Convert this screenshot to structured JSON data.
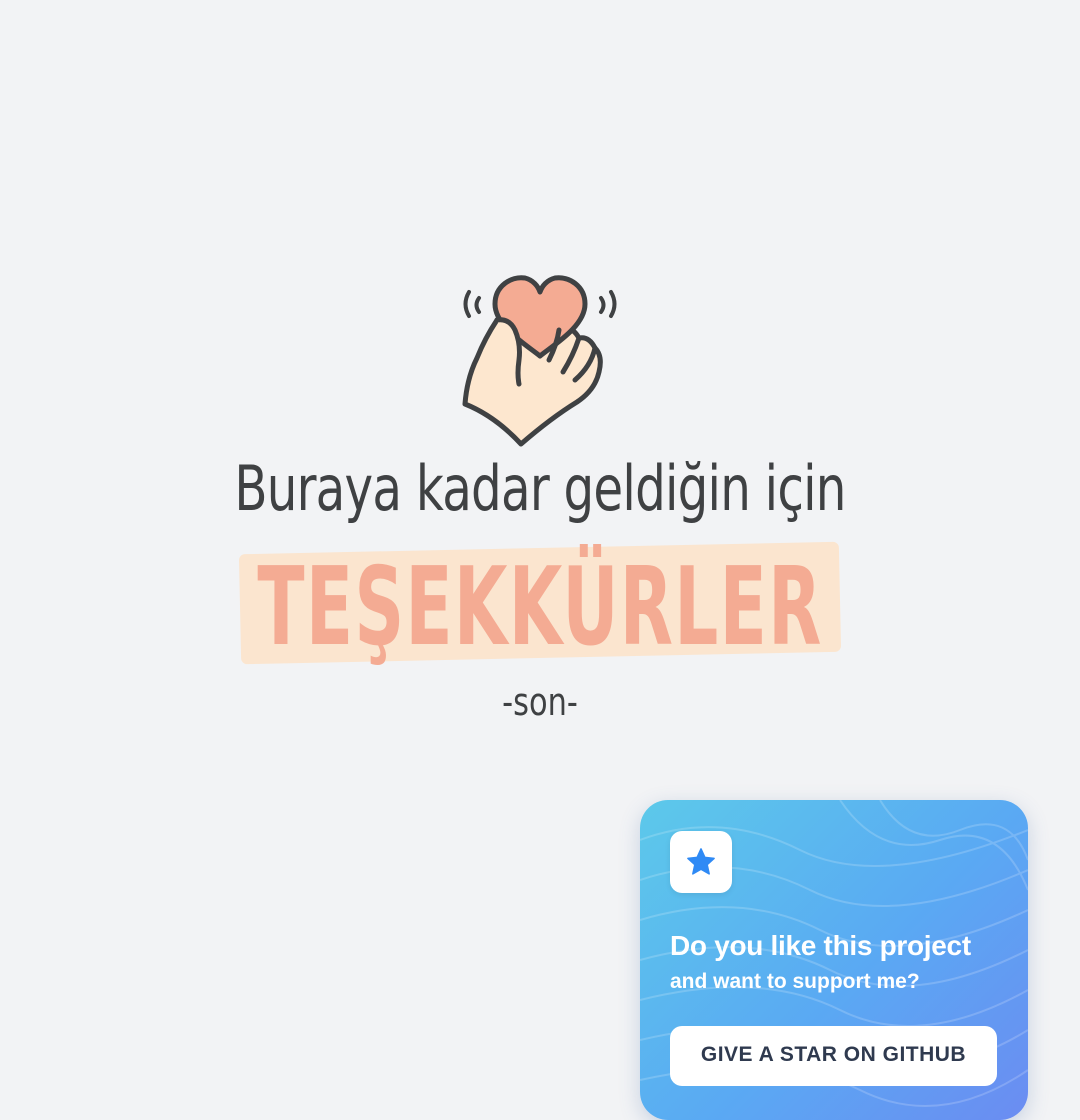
{
  "main": {
    "subtitle": "Buraya kadar geldiğin için",
    "title": "TEŞEKKÜRLER",
    "end_label": "-son-",
    "illustration_icon": "hand-holding-heart-icon"
  },
  "promo": {
    "heading": "Do you like this project",
    "subheading": "and want to support me?",
    "button_label": "GIVE A STAR ON GITHUB",
    "badge_icon": "star-icon"
  },
  "colors": {
    "background": "#f2f3f5",
    "text_dark": "#3f4143",
    "accent_salmon": "#f4ab93",
    "highlight_cream": "#fbe5cf",
    "card_gradient_start": "#5cc9ea",
    "card_gradient_end": "#6b8cf2",
    "star_blue": "#2f8af5"
  }
}
